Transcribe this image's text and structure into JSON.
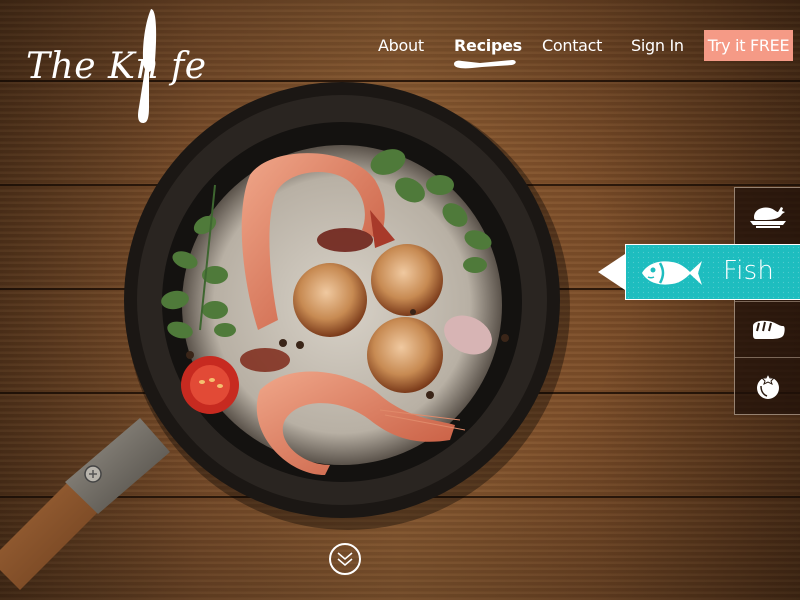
{
  "brand": {
    "logo_text": "The Kn fe"
  },
  "nav": {
    "items": [
      {
        "label": "About",
        "active": false
      },
      {
        "label": "Recipes",
        "active": true
      },
      {
        "label": "Contact",
        "active": false
      },
      {
        "label": "Sign In",
        "active": false
      }
    ],
    "cta_label": "Try it FREE"
  },
  "hero": {
    "image": "seafood-pan"
  },
  "categories": {
    "selected": "Fish",
    "items": [
      {
        "name": "Poultry",
        "icon": "chicken-icon"
      },
      {
        "name": "Fish",
        "icon": "fish-icon",
        "label": "Fish"
      },
      {
        "name": "Meat",
        "icon": "steak-icon"
      },
      {
        "name": "Vegetables",
        "icon": "tomato-icon"
      }
    ]
  },
  "scroll": {
    "icon": "double-chevron-down-icon"
  },
  "colors": {
    "accent_teal": "#1ebdbf",
    "cta_salmon": "#f59a86",
    "wood": "#7d4f2b"
  }
}
